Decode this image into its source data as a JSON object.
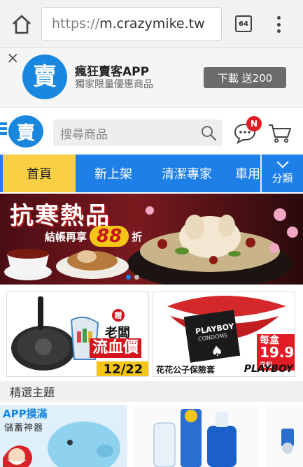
{
  "browser": {
    "url_scheme": "https://",
    "url_host": "m.crazymike.tw",
    "tab_count": "64",
    "icons": {
      "home": "home-icon",
      "menu": "more-vert-icon"
    }
  },
  "app_banner": {
    "close": "×",
    "logo_char": "賣",
    "title": "瘋狂賣客APP",
    "subtitle": "獨家限量優惠商品",
    "download_label": "下載 送200"
  },
  "header": {
    "logo_char": "賣",
    "search_placeholder": "搜尋商品",
    "notification_badge": "N"
  },
  "nav": {
    "items": [
      {
        "label": "首頁",
        "active": true
      },
      {
        "label": "新上架",
        "active": false
      },
      {
        "label": "清潔專家",
        "active": false
      },
      {
        "label": "車用",
        "active": false
      }
    ],
    "more_label": "分類"
  },
  "hero": {
    "title": "抗寒熱品",
    "tag_prefix": "結帳再享",
    "tag_number": "88",
    "tag_suffix": "折"
  },
  "promos": {
    "left": {
      "gift": "贈",
      "line1": "老闆",
      "line2": "流血價",
      "date": "12/22"
    },
    "right": {
      "condom_brand": "PLAYBOY",
      "condom_sub": "CONDOMS",
      "price_prefix": "每盒",
      "price": "19.9",
      "price_suffix": "元起",
      "caption": "花花公子保險套",
      "brand": "PLAYBOY"
    }
  },
  "section": {
    "title": "精選主題",
    "card1_line1": "APP摸滿",
    "card1_line2": "儲蓄神器"
  },
  "colors": {
    "brand_blue": "#1a87de",
    "nav_blue": "#1e7fe6",
    "nav_active": "#f9d043",
    "badge_red": "#e21b25"
  }
}
